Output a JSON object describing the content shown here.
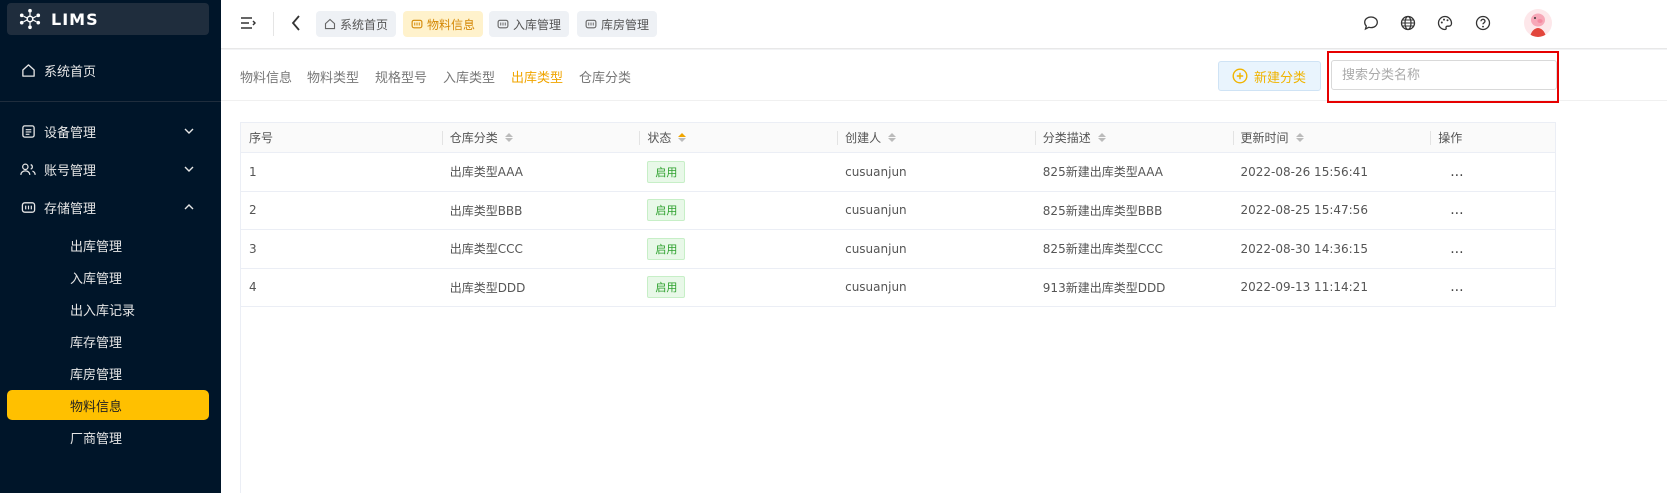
{
  "app": {
    "name": "LIMS"
  },
  "sidebar": {
    "items": [
      {
        "label": "系统首页",
        "icon": "home-icon"
      },
      {
        "label": "设备管理",
        "icon": "device-icon"
      },
      {
        "label": "账号管理",
        "icon": "users-icon"
      },
      {
        "label": "存储管理",
        "icon": "storage-icon"
      }
    ],
    "sub_items": [
      {
        "label": "出库管理"
      },
      {
        "label": "入库管理"
      },
      {
        "label": "出入库记录"
      },
      {
        "label": "库存管理"
      },
      {
        "label": "库房管理"
      },
      {
        "label": "物料信息",
        "active": true
      },
      {
        "label": "厂商管理"
      }
    ]
  },
  "header": {
    "tabs": [
      {
        "label": "系统首页",
        "icon": "home-icon"
      },
      {
        "label": "物料信息",
        "icon": "storage-icon",
        "active": true
      },
      {
        "label": "入库管理",
        "icon": "storage-icon"
      },
      {
        "label": "库房管理",
        "icon": "storage-icon"
      }
    ],
    "right_icons": [
      "chat-icon",
      "globe-icon",
      "palette-icon",
      "help-icon",
      "avatar"
    ]
  },
  "subnav": {
    "tabs": [
      {
        "label": "物料信息"
      },
      {
        "label": "物料类型"
      },
      {
        "label": "规格型号"
      },
      {
        "label": "入库类型"
      },
      {
        "label": "出库类型",
        "active": true
      },
      {
        "label": "仓库分类"
      }
    ],
    "new_button": "新建分类",
    "search_placeholder": "搜索分类名称"
  },
  "table": {
    "headers": [
      "序号",
      "仓库分类",
      "状态",
      "创建人",
      "分类描述",
      "更新时间",
      "操作"
    ],
    "rows": [
      [
        "1",
        "出库类型AAA",
        "启用",
        "cusuanjun",
        "825新建出库类型AAA",
        "2022-08-26 15:56:41",
        "..."
      ],
      [
        "2",
        "出库类型BBB",
        "启用",
        "cusuanjun",
        "825新建出库类型BBB",
        "2022-08-25 15:47:56",
        "..."
      ],
      [
        "3",
        "出库类型CCC",
        "启用",
        "cusuanjun",
        "825新建出库类型CCC",
        "2022-08-30 14:36:15",
        "..."
      ],
      [
        "4",
        "出库类型DDD",
        "启用",
        "cusuanjun",
        "913新建出库类型DDD",
        "2022-09-13 11:14:21",
        "..."
      ]
    ]
  },
  "colors": {
    "accent": "#ffc000",
    "sidebar_bg": "#001529",
    "highlight": "#e60000",
    "status_green": "#2ea12e"
  }
}
